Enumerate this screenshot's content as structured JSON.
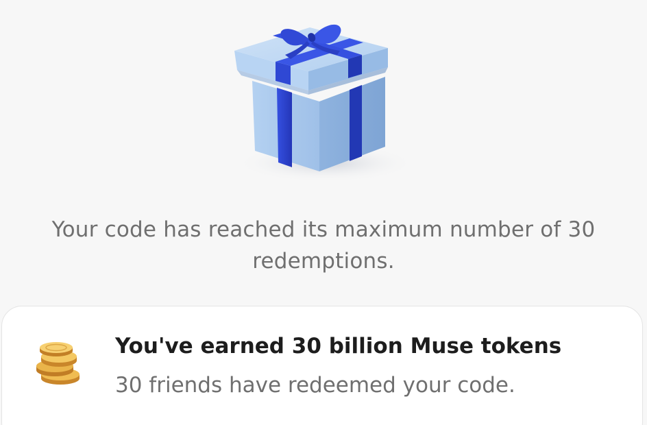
{
  "hero": {
    "icon": "gift-box-icon"
  },
  "message": {
    "line1": "Your code has reached its maximum number of 30",
    "line2": "redemptions."
  },
  "reward_card": {
    "icon": "coins-icon",
    "title": "You've earned 30 billion Muse tokens",
    "subtitle": "30 friends have redeemed your code."
  },
  "colors": {
    "background": "#f7f7f7",
    "box": "#a9c9ee",
    "ribbon": "#2f46d6",
    "coin": "#e3a83d",
    "title_text": "#1d1d1d",
    "secondary_text": "#6f6f6f"
  }
}
